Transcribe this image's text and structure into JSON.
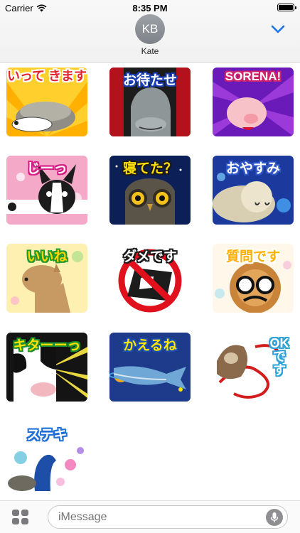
{
  "status_bar": {
    "carrier": "Carrier",
    "time": "8:35 PM"
  },
  "header": {
    "avatar_initials": "KB",
    "contact_name": "Kate",
    "accent_color": "#1a73e8"
  },
  "stickers": [
    {
      "label": "いって きます",
      "label_color": "#e5232f",
      "stroke": "#ffffff"
    },
    {
      "label": "お待たせ",
      "label_color": "#ffffff",
      "stroke": "#1b3fb3"
    },
    {
      "label": "SORENA!",
      "label_color": "#ffffff",
      "stroke": "#d0216b"
    },
    {
      "label": "じーっ",
      "label_color": "#ffffff",
      "stroke": "#d41e86"
    },
    {
      "label": "寝てた？",
      "label_color": "#ffe000",
      "stroke": "#1a1a1a"
    },
    {
      "label": "おやすみ",
      "label_color": "#ffffff",
      "stroke": "#3057c7"
    },
    {
      "label": "いいね",
      "label_color": "#ffd200",
      "stroke": "#1e9a2e"
    },
    {
      "label": "ダメです",
      "label_color": "#ffffff",
      "stroke": "#1a1a1a"
    },
    {
      "label": "質問です",
      "label_color": "#ffb000",
      "stroke": "#ffffff"
    },
    {
      "label": "キターーっ",
      "label_color": "#ffe000",
      "stroke": "#1c8f2c"
    },
    {
      "label": "かえるね",
      "label_color": "#ffe600",
      "stroke": "#1a4db0"
    },
    {
      "label": "OKです",
      "label_color": "#ffffff",
      "stroke": "#2fa3d8"
    },
    {
      "label": "ステキ",
      "label_color": "#ffffff",
      "stroke": "#1f6fd6"
    }
  ],
  "composer": {
    "placeholder": "iMessage"
  }
}
